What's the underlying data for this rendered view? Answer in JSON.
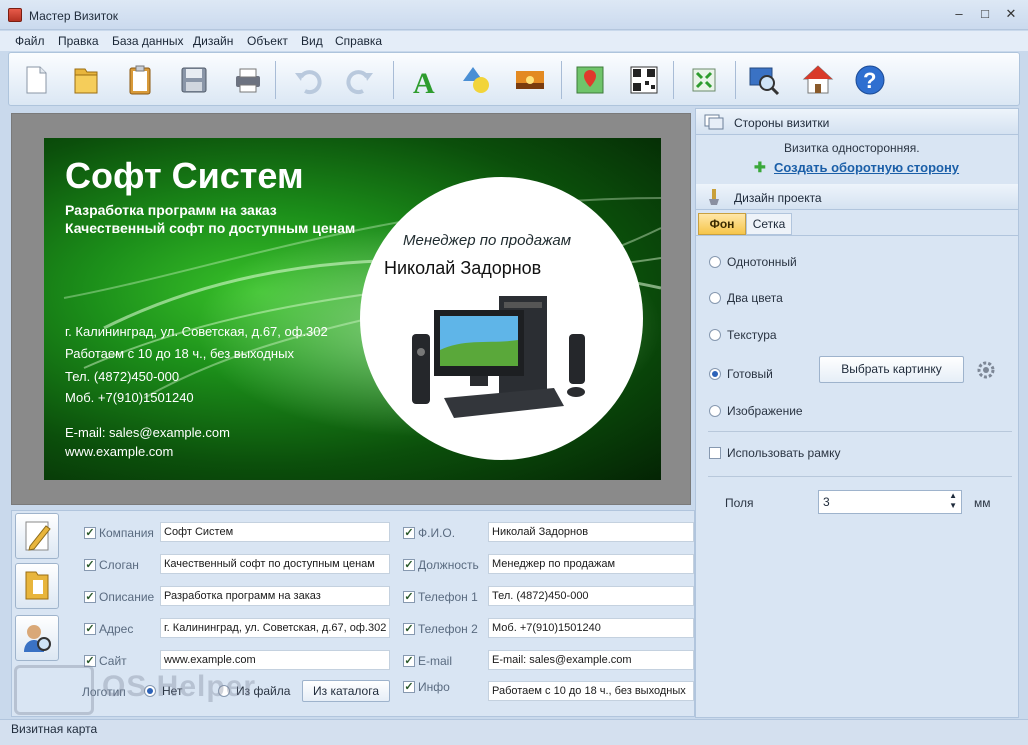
{
  "window": {
    "title": "Мастер Визиток",
    "minimize": "–",
    "maximize": "□",
    "close": "✕"
  },
  "menu": [
    "Файл",
    "Правка",
    "База данных",
    "Дизайн",
    "Объект",
    "Вид",
    "Справка"
  ],
  "toolbar_icons": [
    "new-file-icon",
    "open-folder-icon",
    "clipboard-icon",
    "save-icon",
    "print-icon",
    "undo-icon",
    "redo-icon",
    "text-icon",
    "shapes-icon",
    "image-icon",
    "map-icon",
    "qr-code-icon",
    "fit-screen-icon",
    "preview-icon",
    "home-icon",
    "help-icon"
  ],
  "card": {
    "company": "Софт Систем",
    "slogan": "Разработка программ на заказ",
    "slogan2": "Качественный софт по доступным ценам",
    "role": "Менеджер по продажам",
    "name": "Николай Задорнов",
    "address": "г. Калининград, ул. Советская, д.67, оф.302",
    "hours": "Работаем с 10 до 18 ч., без выходных",
    "phone": "Тел. (4872)450-000",
    "mobile": "Моб. +7(910)1501240",
    "email": "E-mail: sales@example.com",
    "site": "www.example.com"
  },
  "panel": {
    "sides_title": "Стороны визитки",
    "sides_info": "Визитка односторонняя.",
    "create_back": "Создать оборотную сторону",
    "design_title": "Дизайн проекта",
    "tabs": [
      "Фон",
      "Сетка"
    ],
    "bg_options": [
      "Однотонный",
      "Два цвета",
      "Текстура",
      "Готовый",
      "Изображение"
    ],
    "selected_option": "Готовый",
    "choose_picture": "Выбрать картинку",
    "use_frame": "Использовать рамку",
    "margins_label": "Поля",
    "margins_value": "3",
    "margins_unit": "мм"
  },
  "fields_left": [
    {
      "label": "Компания",
      "value": "Софт Систем"
    },
    {
      "label": "Слоган",
      "value": "Качественный софт по доступным ценам"
    },
    {
      "label": "Описание",
      "value": "Разработка программ на заказ"
    },
    {
      "label": "Адрес",
      "value": "г. Калининград, ул. Советская, д.67, оф.302"
    },
    {
      "label": "Сайт",
      "value": "www.example.com"
    }
  ],
  "fields_right": [
    {
      "label": "Ф.И.О.",
      "value": "Николай Задорнов"
    },
    {
      "label": "Должность",
      "value": "Менеджер по продажам"
    },
    {
      "label": "Телефон 1",
      "value": "Тел. (4872)450-000"
    },
    {
      "label": "Телефон 2",
      "value": "Моб. +7(910)1501240"
    },
    {
      "label": "E-mail",
      "value": "E-mail: sales@example.com"
    },
    {
      "label": "Инфо",
      "value": "Работаем с 10 до 18 ч., без выходных"
    }
  ],
  "logo_row": {
    "label": "Логотип",
    "none": "Нет",
    "from_file": "Из файла",
    "from_catalog": "Из каталога"
  },
  "status": "Визитная карта",
  "watermark": "OS Helper"
}
